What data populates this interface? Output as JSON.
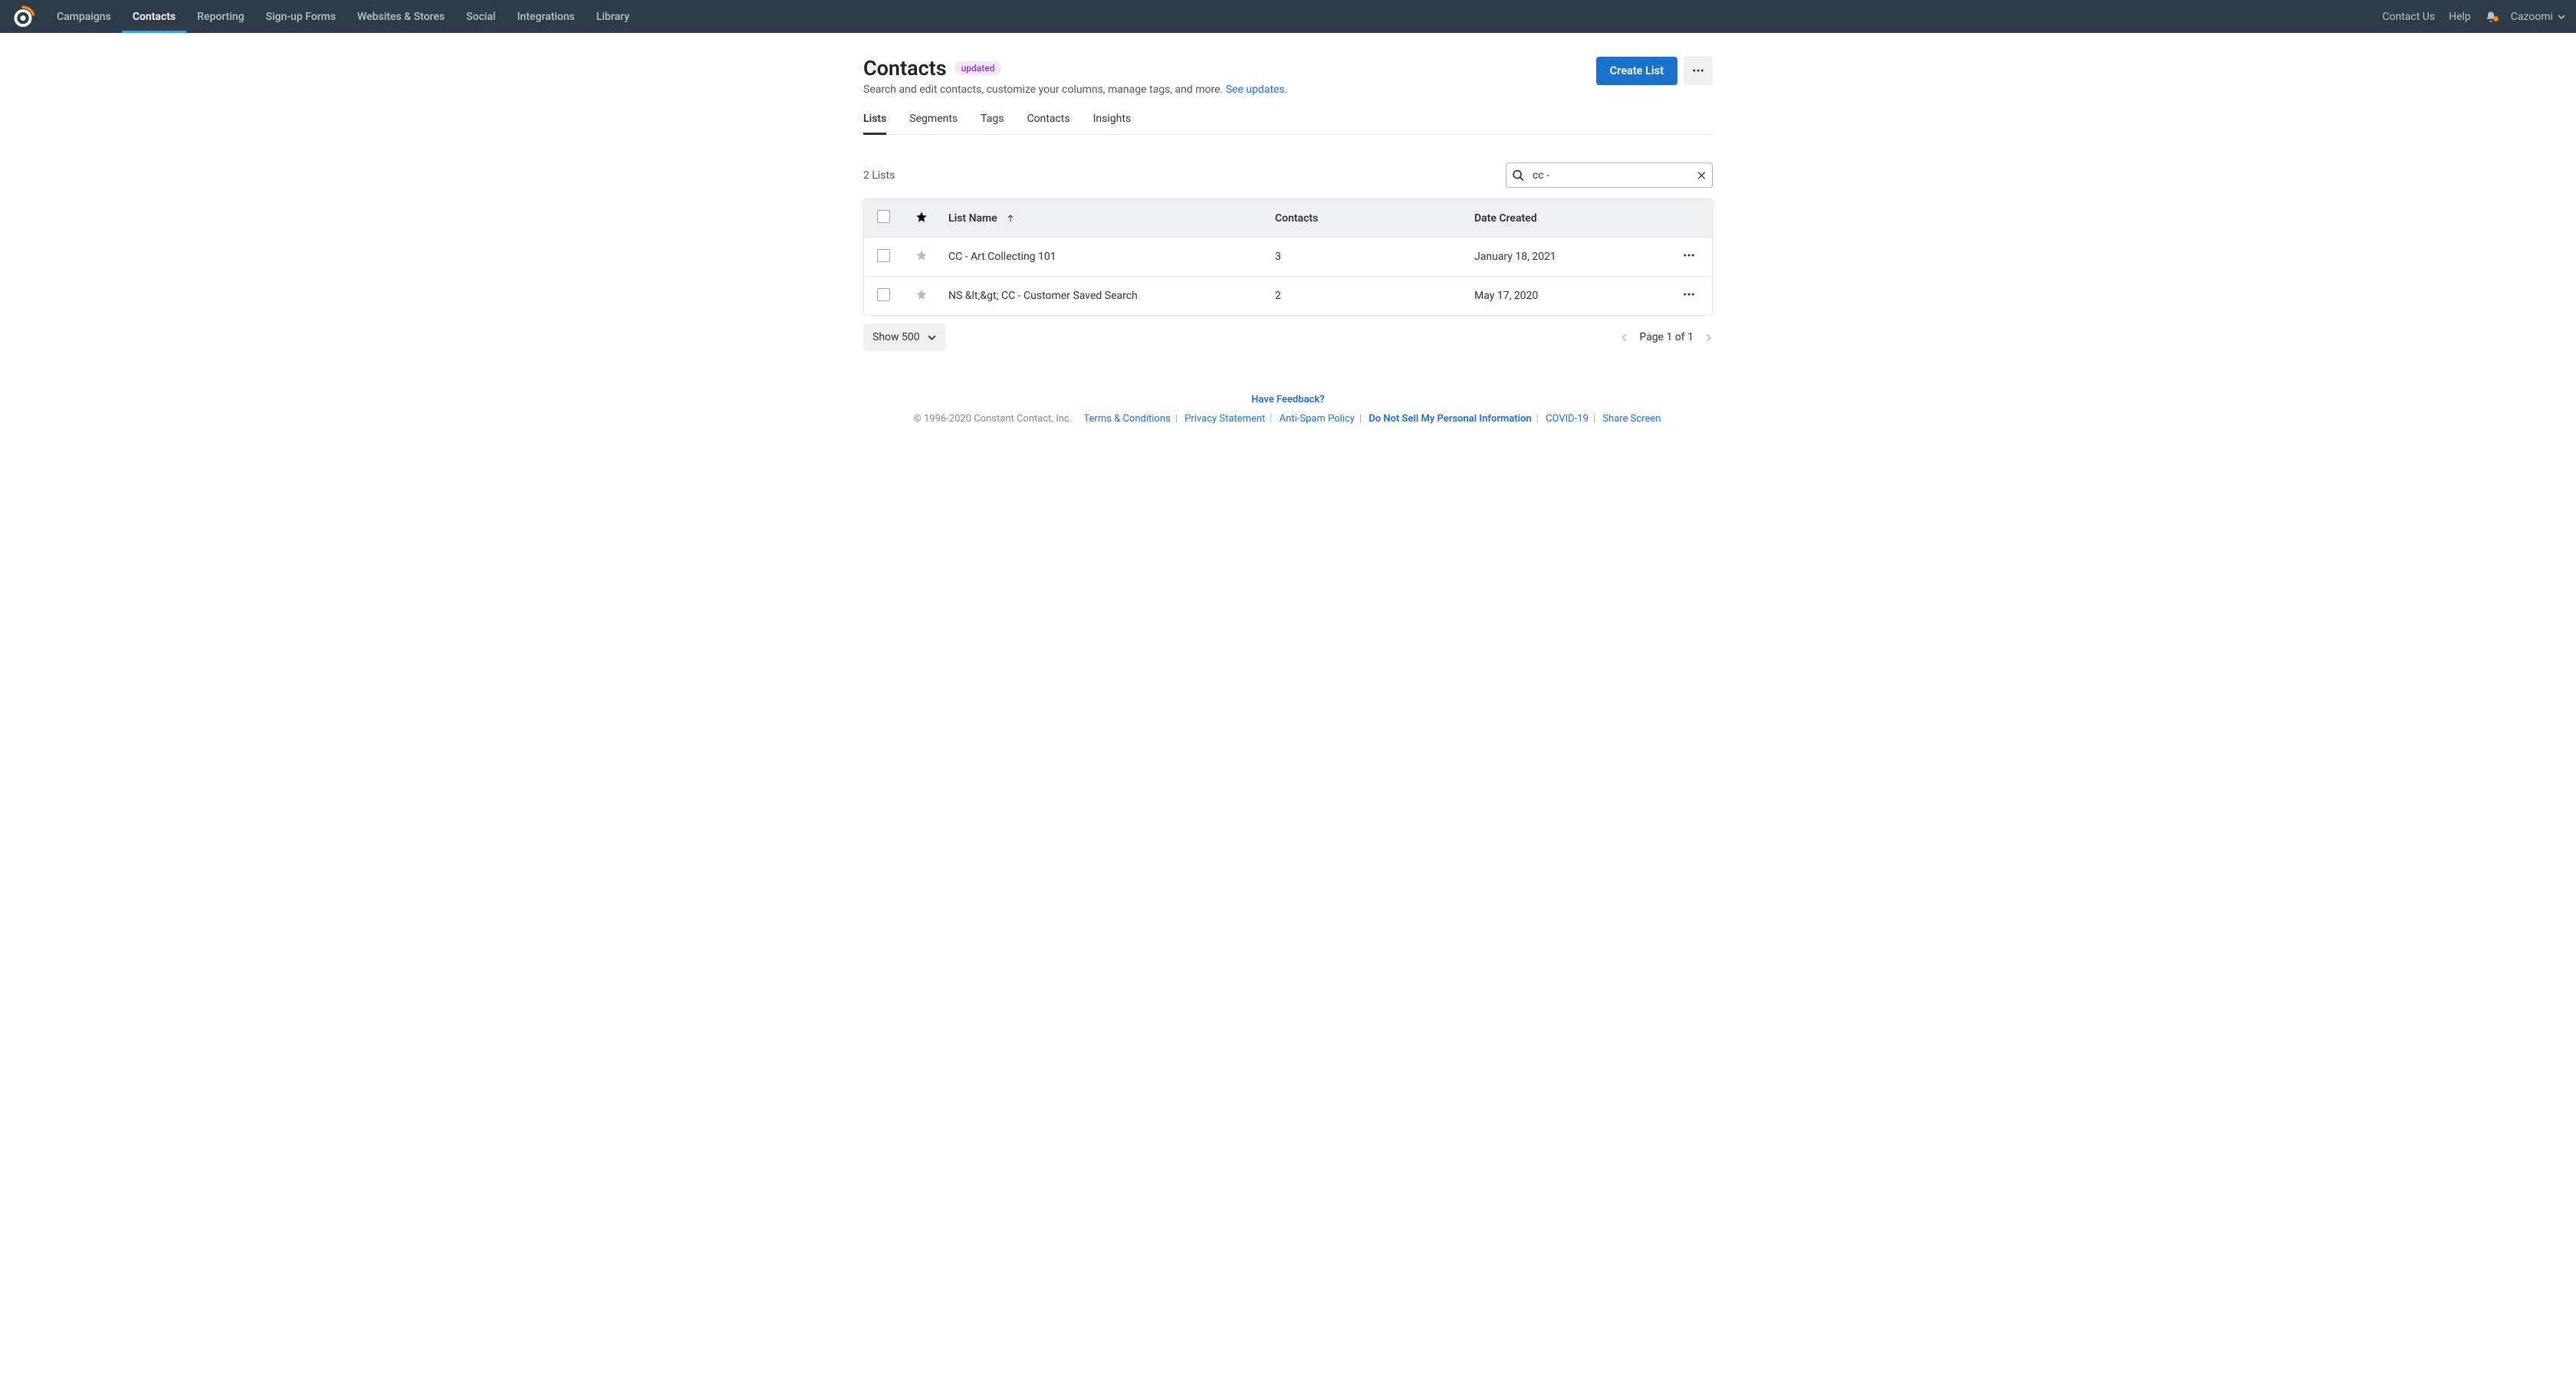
{
  "topnav": {
    "items": [
      "Campaigns",
      "Contacts",
      "Reporting",
      "Sign-up Forms",
      "Websites & Stores",
      "Social",
      "Integrations",
      "Library"
    ],
    "active_index": 1,
    "right": {
      "contact_us": "Contact Us",
      "help": "Help",
      "account": "Cazoomi"
    }
  },
  "header": {
    "title": "Contacts",
    "badge": "updated",
    "subtitle_text": "Search and edit contacts, customize your columns, manage tags, and more. ",
    "subtitle_link": "See updates.",
    "create_button": "Create List"
  },
  "subnav": {
    "tabs": [
      "Lists",
      "Segments",
      "Tags",
      "Contacts",
      "Insights"
    ],
    "active_index": 0
  },
  "toolbar": {
    "count_text": "2 Lists",
    "search_value": "cc -"
  },
  "table": {
    "columns": {
      "name": "List Name",
      "contacts": "Contacts",
      "date": "Date Created"
    },
    "rows": [
      {
        "name": "CC - Art Collecting 101",
        "contacts": "3",
        "date": "January 18, 2021"
      },
      {
        "name": "NS &lt;&gt; CC - Customer Saved Search",
        "contacts": "2",
        "date": "May 17, 2020"
      }
    ]
  },
  "table_footer": {
    "show_label": "Show 500",
    "page_text": "Page 1 of 1"
  },
  "footer": {
    "feedback": "Have Feedback?",
    "copyright": "© 1996-2020 Constant Contact, Inc.",
    "links": [
      "Terms & Conditions",
      "Privacy Statement",
      "Anti-Spam Policy",
      "Do Not Sell My Personal Information",
      "COVID-19",
      "Share Screen"
    ]
  }
}
